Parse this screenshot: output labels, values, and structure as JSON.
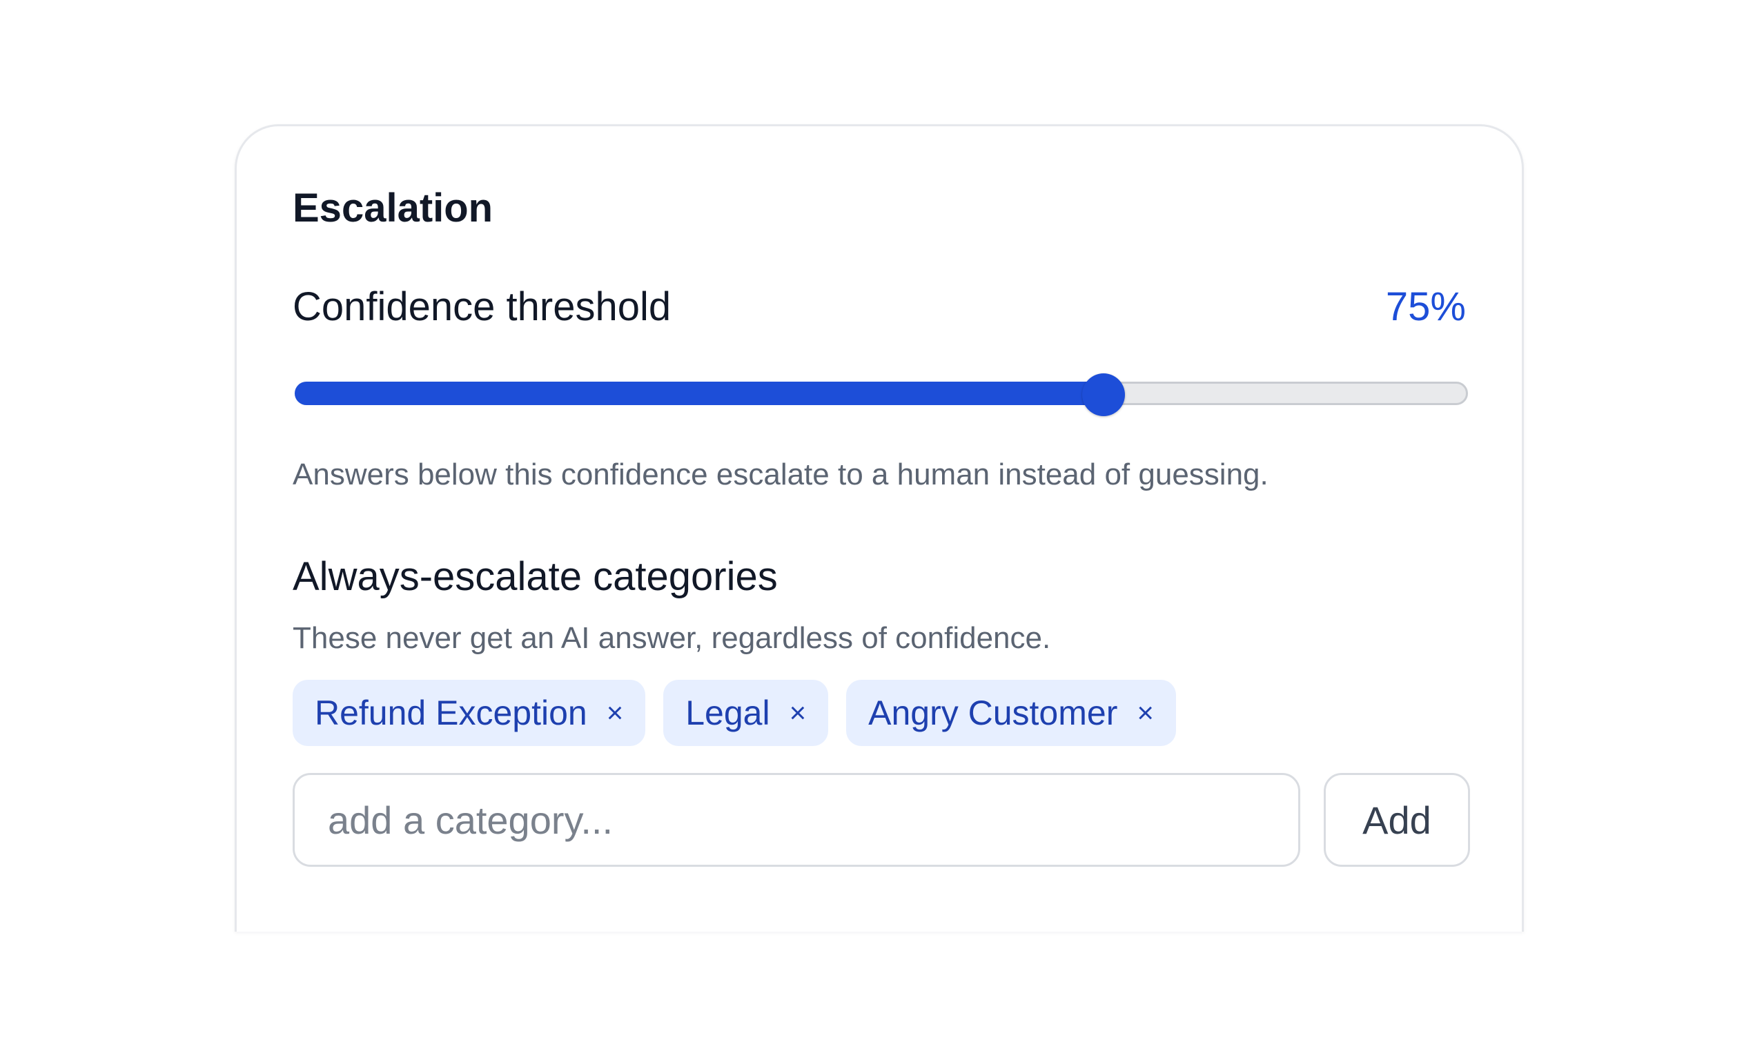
{
  "card": {
    "title": "Escalation"
  },
  "confidence": {
    "label": "Confidence threshold",
    "value_text": "75%",
    "value": 0.69,
    "help": "Answers below this confidence escalate to a human instead of guessing."
  },
  "categories": {
    "title": "Always-escalate categories",
    "subtitle": "These never get an AI answer, regardless of confidence.",
    "chips": [
      {
        "label": "Refund Exception",
        "remove_glyph": "×"
      },
      {
        "label": "Legal",
        "remove_glyph": "×"
      },
      {
        "label": "Angry Customer",
        "remove_glyph": "×"
      }
    ],
    "input_placeholder": "add a category...",
    "add_label": "Add"
  },
  "colors": {
    "accent": "#1d4ed8",
    "chip_bg": "#e7efff",
    "chip_text": "#1e40af"
  }
}
